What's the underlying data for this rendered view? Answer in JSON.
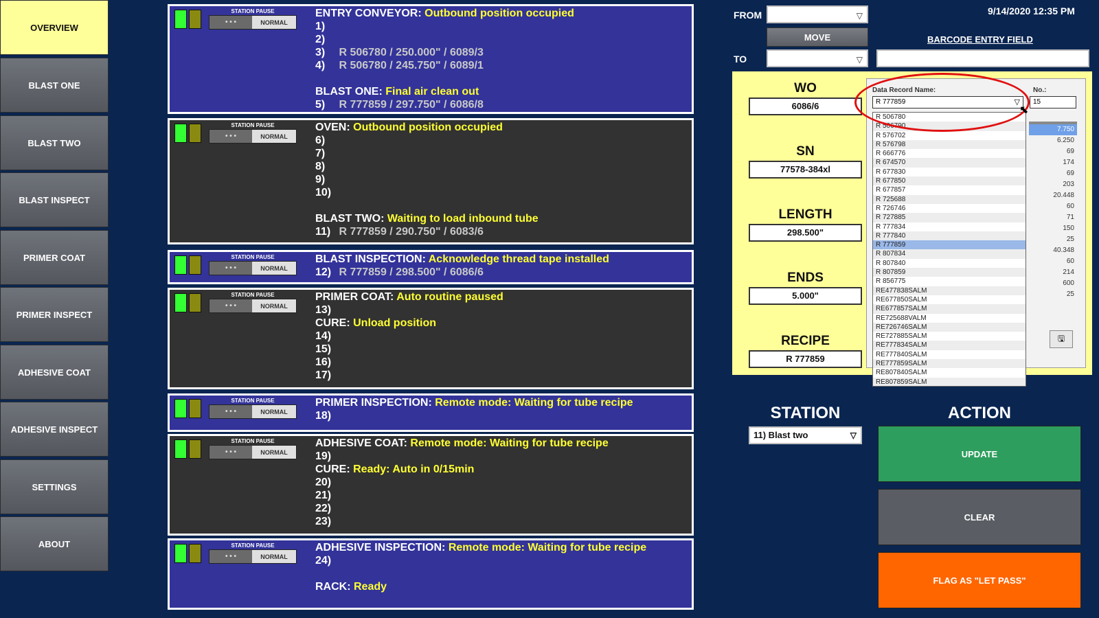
{
  "nav": {
    "items": [
      {
        "label": "OVERVIEW",
        "active": true
      },
      {
        "label": "BLAST ONE",
        "active": false
      },
      {
        "label": "BLAST TWO",
        "active": false
      },
      {
        "label": "BLAST INSPECT",
        "active": false
      },
      {
        "label": "PRIMER COAT",
        "active": false
      },
      {
        "label": "PRIMER INSPECT",
        "active": false
      },
      {
        "label": "ADHESIVE COAT",
        "active": false
      },
      {
        "label": "ADHESIVE INSPECT",
        "active": false
      },
      {
        "label": "SETTINGS",
        "active": false
      },
      {
        "label": "ABOUT",
        "active": false
      }
    ]
  },
  "station_pause": {
    "label": "STATION PAUSE",
    "off_label": "• • •",
    "normal_label": "NORMAL"
  },
  "panels": [
    {
      "bg": "blue",
      "lines": [
        {
          "label": "ENTRY CONVEYOR:",
          "status": "Outbound position occupied"
        },
        {
          "num": "1)",
          "value": ""
        },
        {
          "num": "2)",
          "value": ""
        },
        {
          "num": "3)",
          "value": "R 506780 / 250.000\" / 6089/3"
        },
        {
          "num": "4)",
          "value": "R 506780 / 245.750\" / 6089/1"
        },
        {
          "blank": true
        },
        {
          "label": "BLAST ONE:",
          "status": "Final air clean out"
        },
        {
          "num": "5)",
          "value": "R 777859 / 297.750\" / 6086/8"
        }
      ]
    },
    {
      "bg": "dark",
      "lines": [
        {
          "label": "OVEN:",
          "status": "Outbound position occupied"
        },
        {
          "num": "6)",
          "value": ""
        },
        {
          "num": "7)",
          "value": ""
        },
        {
          "num": "8)",
          "value": ""
        },
        {
          "num": "9)",
          "value": ""
        },
        {
          "num": "10)",
          "value": ""
        },
        {
          "blank": true
        },
        {
          "label": "BLAST TWO:",
          "status": "Waiting to load inbound tube"
        },
        {
          "num": "11)",
          "value": "R 777859 / 290.750\" / 6083/6"
        }
      ]
    },
    {
      "bg": "blue",
      "lines": [
        {
          "label": "BLAST INSPECTION:",
          "status": "Acknowledge thread tape installed"
        },
        {
          "num": "12)",
          "value": "R 777859 / 298.500\" / 6086/6"
        }
      ]
    },
    {
      "bg": "dark",
      "lines": [
        {
          "label": "PRIMER COAT:",
          "status": "Auto routine paused"
        },
        {
          "num": "13)",
          "value": ""
        },
        {
          "label": "CURE:",
          "status": "Unload position"
        },
        {
          "num": "14)",
          "value": ""
        },
        {
          "num": "15)",
          "value": ""
        },
        {
          "num": "16)",
          "value": ""
        },
        {
          "num": "17)",
          "value": ""
        }
      ]
    },
    {
      "bg": "blue",
      "lines": [
        {
          "label": "PRIMER INSPECTION:",
          "status": "Remote mode: Waiting for tube recipe"
        },
        {
          "num": "18)",
          "value": ""
        }
      ]
    },
    {
      "bg": "dark",
      "lines": [
        {
          "label": "ADHESIVE COAT:",
          "status": "Remote mode: Waiting for tube recipe"
        },
        {
          "num": "19)",
          "value": ""
        },
        {
          "label": "CURE:",
          "status": "Ready: Auto in 0/15min"
        },
        {
          "num": "20)",
          "value": ""
        },
        {
          "num": "21)",
          "value": ""
        },
        {
          "num": "22)",
          "value": ""
        },
        {
          "num": "23)",
          "value": ""
        }
      ]
    },
    {
      "bg": "blue",
      "lines": [
        {
          "label": "ADHESIVE INSPECTION:",
          "status": "Remote mode: Waiting for tube recipe"
        },
        {
          "num": "24)",
          "value": ""
        },
        {
          "blank": true
        },
        {
          "label": "RACK:",
          "status": "Ready"
        }
      ]
    }
  ],
  "transfer": {
    "from_label": "FROM",
    "to_label": "TO",
    "move_label": "MOVE"
  },
  "datetime": "9/14/2020 12:35 PM",
  "barcode": {
    "label": "BARCODE ENTRY FIELD",
    "value": ""
  },
  "fields": {
    "wo": {
      "label": "WO",
      "value": "6086/6"
    },
    "sn": {
      "label": "SN",
      "value": "77578-384xl"
    },
    "length": {
      "label": "LENGTH",
      "value": "298.500\""
    },
    "ends": {
      "label": "ENDS",
      "value": "5.000\""
    },
    "recipe": {
      "label": "RECIPE",
      "value": "R 777859"
    }
  },
  "popup": {
    "record_label": "Data Record Name:",
    "no_label": "No.:",
    "selected_record": "R 777859",
    "no_value": "15",
    "numbers": [
      "7.750",
      "6.250",
      "69",
      "174",
      "69",
      "203",
      "20.448",
      "60",
      "71",
      "150",
      "25",
      "40.348",
      "60",
      "214",
      "600",
      "25"
    ],
    "save_icon": "save-icon"
  },
  "dropdown": {
    "items": [
      "R 506780",
      "R 506790",
      "R 576702",
      "R 576798",
      "R 666776",
      "R 674570",
      "R 677830",
      "R 677850",
      "R 677857",
      "R 725688",
      "R 726746",
      "R 727885",
      "R 777834",
      "R 777840",
      "R 777859",
      "R 807834",
      "R 807840",
      "R 807859",
      "R 856775",
      "RE477838SALM",
      "RE677850SALM",
      "RE677857SALM",
      "RE725688VALM",
      "RE726746SALM",
      "RE727885SALM",
      "RE777834SALM",
      "RE777840SALM",
      "RE777859SALM",
      "RE807840SALM",
      "RE807859SALM"
    ],
    "selected_index": 14
  },
  "station": {
    "title": "STATION",
    "value": "11) Blast two"
  },
  "action": {
    "title": "ACTION",
    "update_label": "UPDATE",
    "clear_label": "CLEAR",
    "flag_label": "FLAG AS \"LET PASS\""
  },
  "colors": {
    "accent_yellow": "#ffff33",
    "panel_blue": "#33339a",
    "panel_dark": "#323232",
    "update_green": "#2e9e5e",
    "flag_orange": "#ff6600",
    "highlight_red": "#e01010"
  }
}
